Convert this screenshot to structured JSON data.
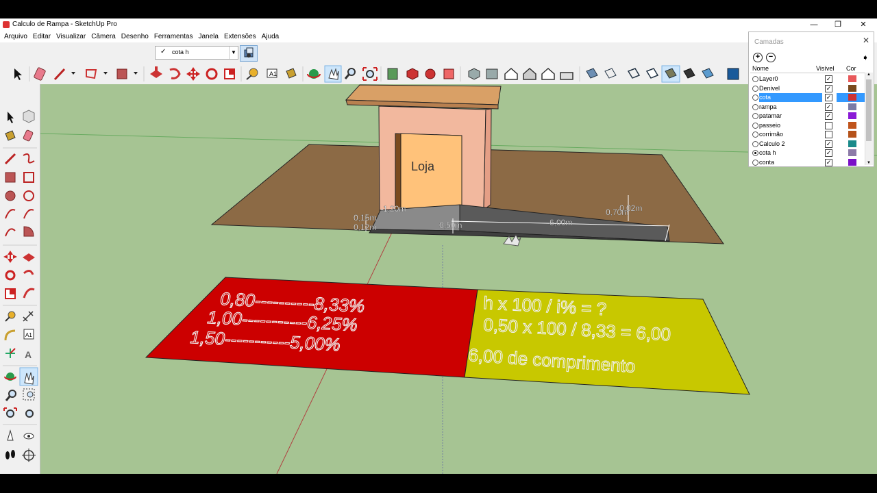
{
  "window": {
    "title": "Calculo de Rampa - SketchUp Pro",
    "controls": [
      "—",
      "❐",
      "✕"
    ]
  },
  "menu": [
    "Arquivo",
    "Editar",
    "Visualizar",
    "Câmera",
    "Desenho",
    "Ferramentas",
    "Janela",
    "Extensões",
    "Ajuda"
  ],
  "layer_selector": {
    "check": "✓",
    "value": "cota h"
  },
  "layers_panel": {
    "title": "Camadas",
    "add": "+",
    "remove": "−",
    "columns": {
      "name": "Nome",
      "visible": "Visível",
      "color": "Cor"
    },
    "rows": [
      {
        "name": "Layer0",
        "visible": true,
        "color": "#e8585a",
        "active": false
      },
      {
        "name": "Denivel",
        "visible": true,
        "color": "#7a4a1e",
        "active": false
      },
      {
        "name": "cota",
        "visible": true,
        "color": "#cc3333",
        "active": false,
        "selected": true
      },
      {
        "name": "rampa",
        "visible": true,
        "color": "#7b7ba6",
        "active": false
      },
      {
        "name": "patamar",
        "visible": true,
        "color": "#8a1ad6",
        "active": false
      },
      {
        "name": "passeio",
        "visible": false,
        "color": "#c0541c",
        "active": false
      },
      {
        "name": "corrimão",
        "visible": false,
        "color": "#b5521a",
        "active": false
      },
      {
        "name": "Calculo 2",
        "visible": true,
        "color": "#1a8a8a",
        "active": false
      },
      {
        "name": "cota h",
        "visible": true,
        "color": "#8c7ba8",
        "active": true
      },
      {
        "name": "conta",
        "visible": true,
        "color": "#7a10c8",
        "active": false
      }
    ]
  },
  "scene": {
    "store_label": "Loja",
    "dims": {
      "d1": "1,20m",
      "d2": "0,15m",
      "d3": "0,12m",
      "d4": "0,50m",
      "d5": "6,00m",
      "d6": "0,70m",
      "d7": "0,02m"
    },
    "red_lines": [
      "0,80----------8,33%",
      "1,00-----------6,25%",
      "1,50-----------5,00%"
    ],
    "yellow_lines": [
      "h x 100 / i% = ?",
      "0,50 x 100 / 8,33 = 6,00",
      "6,00 de comprimento"
    ],
    "colors": {
      "ground": "#a6c493",
      "terrain": "#8c6a45",
      "ramp": "#6e6e6e",
      "red_panel": "#cc0000",
      "yellow_panel": "#c8c800",
      "store_wall": "#f2b89e",
      "store_roof": "#d9a066",
      "store_door": "#ffc27a"
    }
  }
}
